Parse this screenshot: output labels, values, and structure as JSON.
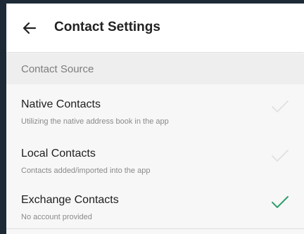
{
  "header": {
    "title": "Contact Settings",
    "back_icon": "arrow-left-icon"
  },
  "section": {
    "title": "Contact Source"
  },
  "items": [
    {
      "title": "Native Contacts",
      "subtitle": "Utilizing the native address book in the app",
      "checked": false
    },
    {
      "title": "Local Contacts",
      "subtitle": "Contacts added/imported into the app",
      "checked": false
    },
    {
      "title": "Exchange Contacts",
      "subtitle": "No account provided",
      "checked": true
    }
  ],
  "colors": {
    "check_active": "#2e9e6e",
    "check_inactive": "#e0e0e0",
    "frame": "#1e2a36"
  }
}
